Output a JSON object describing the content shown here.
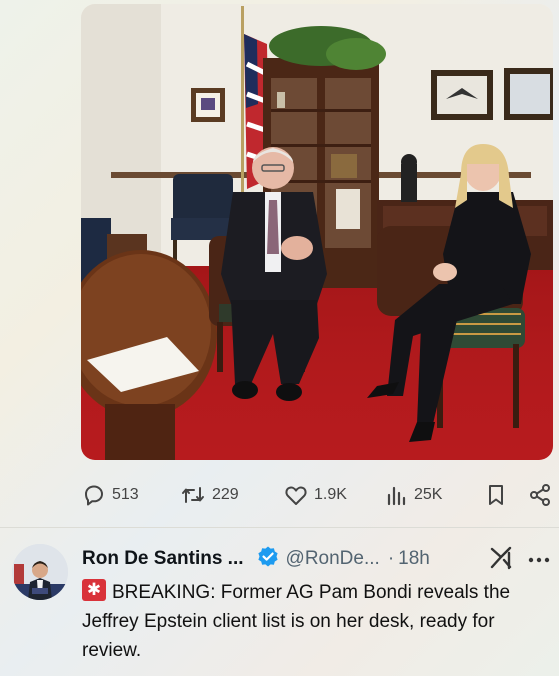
{
  "post": {
    "image": {
      "icon": "office-photo"
    },
    "metrics": {
      "replies": "513",
      "reposts": "229",
      "likes": "1.9K",
      "views": "25K"
    }
  },
  "tweet": {
    "author_name": "Ron De Santins ...",
    "handle": "@RonDe...",
    "separator": "·",
    "time": "18h",
    "text": "BREAKING: Former AG Pam Bondi reveals the Jeffrey Epstein client list is on her desk, ready for review.",
    "colors": {
      "verified": "#1d9bf0",
      "siren": "#d9323a"
    }
  }
}
